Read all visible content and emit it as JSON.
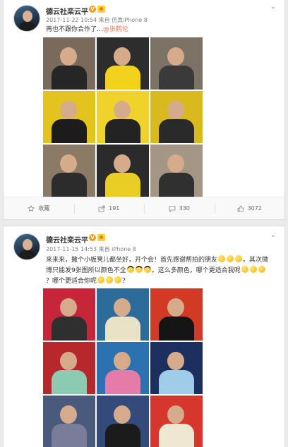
{
  "posts": [
    {
      "author": "德云社栾云平",
      "timestamp": "2017-11-22 10:54",
      "source": "来自 仿真iPhone 8",
      "text_prefix": "再也不跟你合作了…",
      "mention": "@张鹤伦",
      "images": [
        {
          "bg": "#7a6a5c",
          "body": "#262626"
        },
        {
          "bg": "#2d2d2d",
          "body": "#f2d21c"
        },
        {
          "bg": "#7c7266",
          "body": "#3a3a3a"
        },
        {
          "bg": "#e3c41e",
          "body": "#1c1c1c"
        },
        {
          "bg": "#efd22a",
          "body": "#232323"
        },
        {
          "bg": "#d8ba1e",
          "body": "#2a2a2a"
        },
        {
          "bg": "#8a7a66",
          "body": "#2c2c2c"
        },
        {
          "bg": "#2b2b2b",
          "body": "#e9cd24"
        },
        {
          "bg": "#a39684",
          "body": "#303030"
        }
      ],
      "actions": [
        {
          "icon": "star-icon",
          "label": "收藏"
        },
        {
          "icon": "share-icon",
          "label": "191"
        },
        {
          "icon": "comment-icon",
          "label": "330"
        },
        {
          "icon": "like-icon",
          "label": "3072"
        }
      ]
    },
    {
      "author": "德云社栾云平",
      "timestamp": "2017-11-15 14:53",
      "source": "来自 iPhone 8",
      "text_a": "来来来，撒个小板凳儿都坐好，开个会！首先感谢帮拍的朋友",
      "text_b": "。其次微博只能发9张图所以颜色不全",
      "text_c": "。这么多颜色，哪个更适合我呢",
      "text_d": "？哪个更适合你呢",
      "text_e": "？",
      "images": [
        {
          "bg": "#c7263a",
          "body": "#2f2f2f"
        },
        {
          "bg": "#2c6c9a",
          "body": "#e9e2c6"
        },
        {
          "bg": "#d23a25",
          "body": "#151515"
        },
        {
          "bg": "#b7282c",
          "body": "#8ccbb2"
        },
        {
          "bg": "#2d72b0",
          "body": "#e57ba8"
        },
        {
          "bg": "#1d2f5e",
          "body": "#9fcde9"
        },
        {
          "bg": "#4a5a7c",
          "body": "#7a7d9a"
        },
        {
          "bg": "#334a7a",
          "body": "#1b1b1b"
        },
        {
          "bg": "#d7362d",
          "body": "#f0e7d2"
        }
      ]
    }
  ],
  "colors": {
    "mention": "#eb7350",
    "verified": "#f39b1b"
  }
}
